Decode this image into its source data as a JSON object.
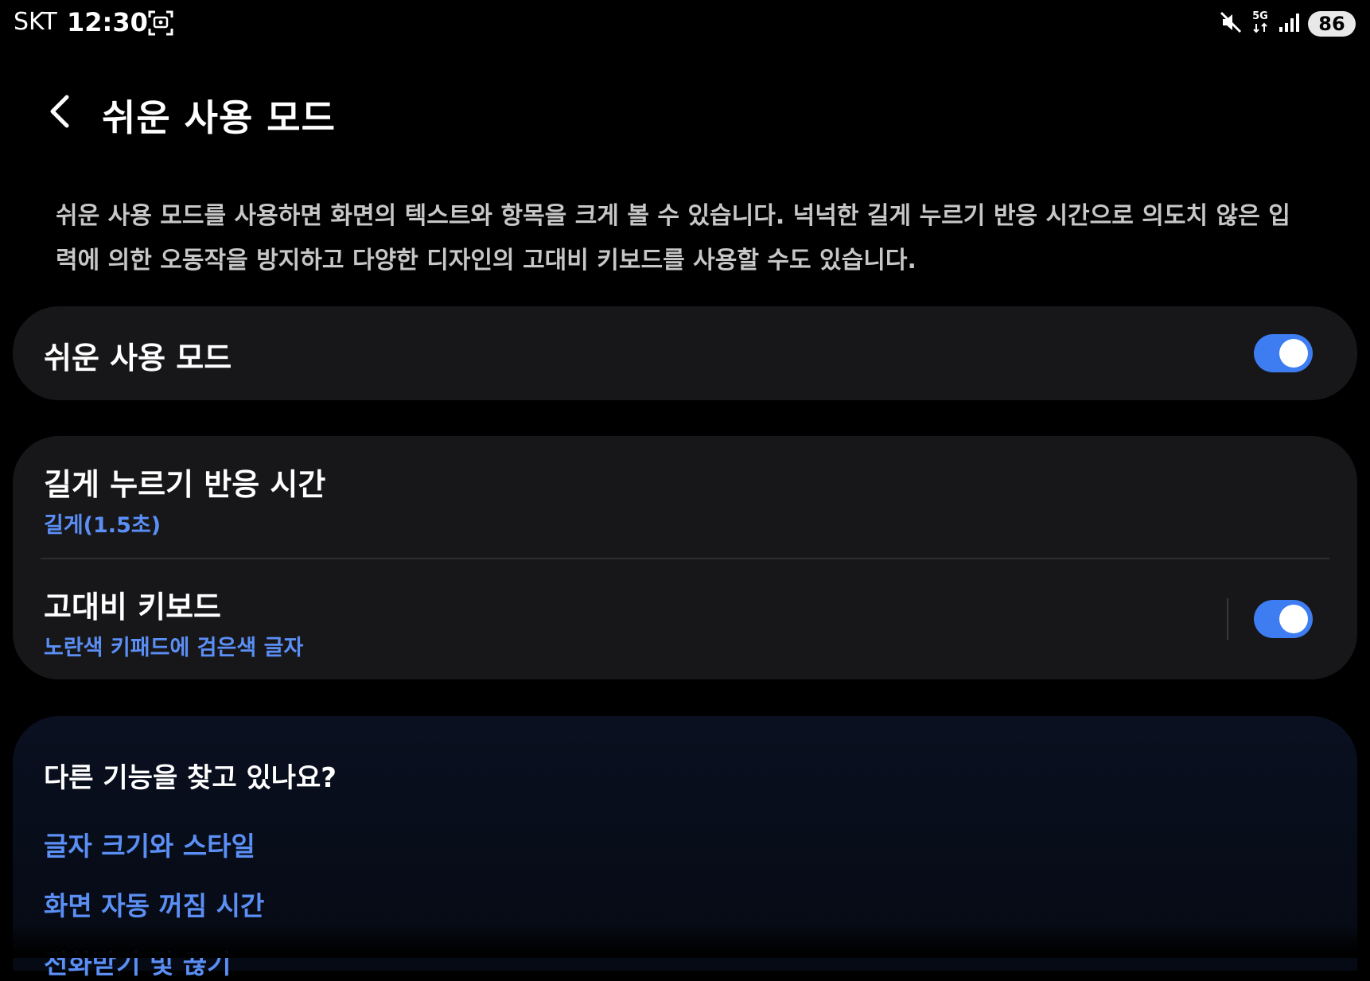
{
  "status_bar": {
    "carrier": "SKT",
    "time": "12:30",
    "network": "5G",
    "battery": "86"
  },
  "header": {
    "title": "쉬운 사용 모드"
  },
  "description": "쉬운 사용 모드를 사용하면 화면의 텍스트와 항목을 크게 볼 수 있습니다. 넉넉한 길게 누르기 반응 시간으로 의도치 않은 입력에 의한 오동작을 방지하고 다양한 디자인의 고대비 키보드를 사용할 수도 있습니다.",
  "main_toggle": {
    "label": "쉬운 사용 모드",
    "enabled": true
  },
  "settings": [
    {
      "title": "길게 누르기 반응 시간",
      "value": "길게(1.5초)"
    },
    {
      "title": "고대비 키보드",
      "value": "노란색 키패드에 검은색 글자",
      "enabled": true
    }
  ],
  "related": {
    "title": "다른 기능을 찾고 있나요?",
    "links": [
      "글자 크기와 스타일",
      "화면 자동 꺼짐 시간",
      "전화받기 및 끊기"
    ]
  },
  "colors": {
    "accent": "#3e7df1",
    "link": "#5b8ff5",
    "card": "#17171a"
  }
}
